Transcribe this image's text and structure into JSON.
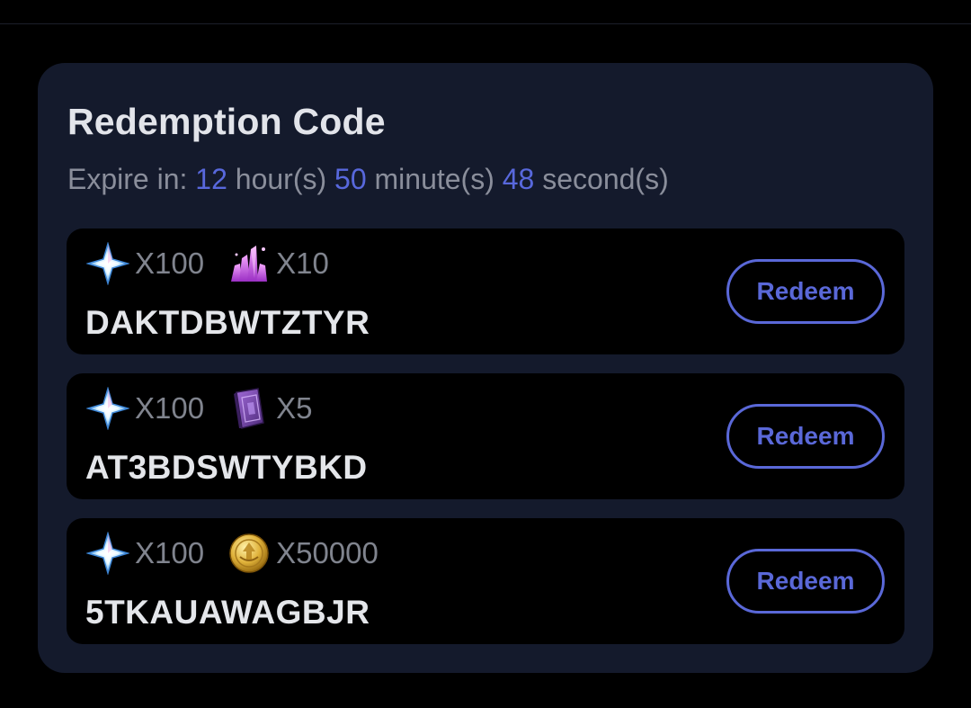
{
  "header": {
    "title": "Redemption Code"
  },
  "expiry": {
    "prefix": "Expire in: ",
    "hours": "12",
    "hours_unit": " hour(s) ",
    "minutes": "50",
    "minutes_unit": " minute(s) ",
    "seconds": "48",
    "seconds_unit": " second(s)"
  },
  "colors": {
    "accent": "#5a68d8",
    "card_bg": "#141a2c",
    "row_bg": "#000000",
    "page_bg": "#000000"
  },
  "codes": [
    {
      "code": "DAKTDBWTZTYR",
      "redeem_label": "Redeem",
      "rewards": [
        {
          "icon": "primogem-icon",
          "qty": "X100"
        },
        {
          "icon": "crystal-cluster-icon",
          "qty": "X10"
        }
      ]
    },
    {
      "code": "AT3BDSWTYBKD",
      "redeem_label": "Redeem",
      "rewards": [
        {
          "icon": "primogem-icon",
          "qty": "X100"
        },
        {
          "icon": "hero-wit-book-icon",
          "qty": "X5"
        }
      ]
    },
    {
      "code": "5TKAUAWAGBJR",
      "redeem_label": "Redeem",
      "rewards": [
        {
          "icon": "primogem-icon",
          "qty": "X100"
        },
        {
          "icon": "mora-coin-icon",
          "qty": "X50000"
        }
      ]
    }
  ]
}
